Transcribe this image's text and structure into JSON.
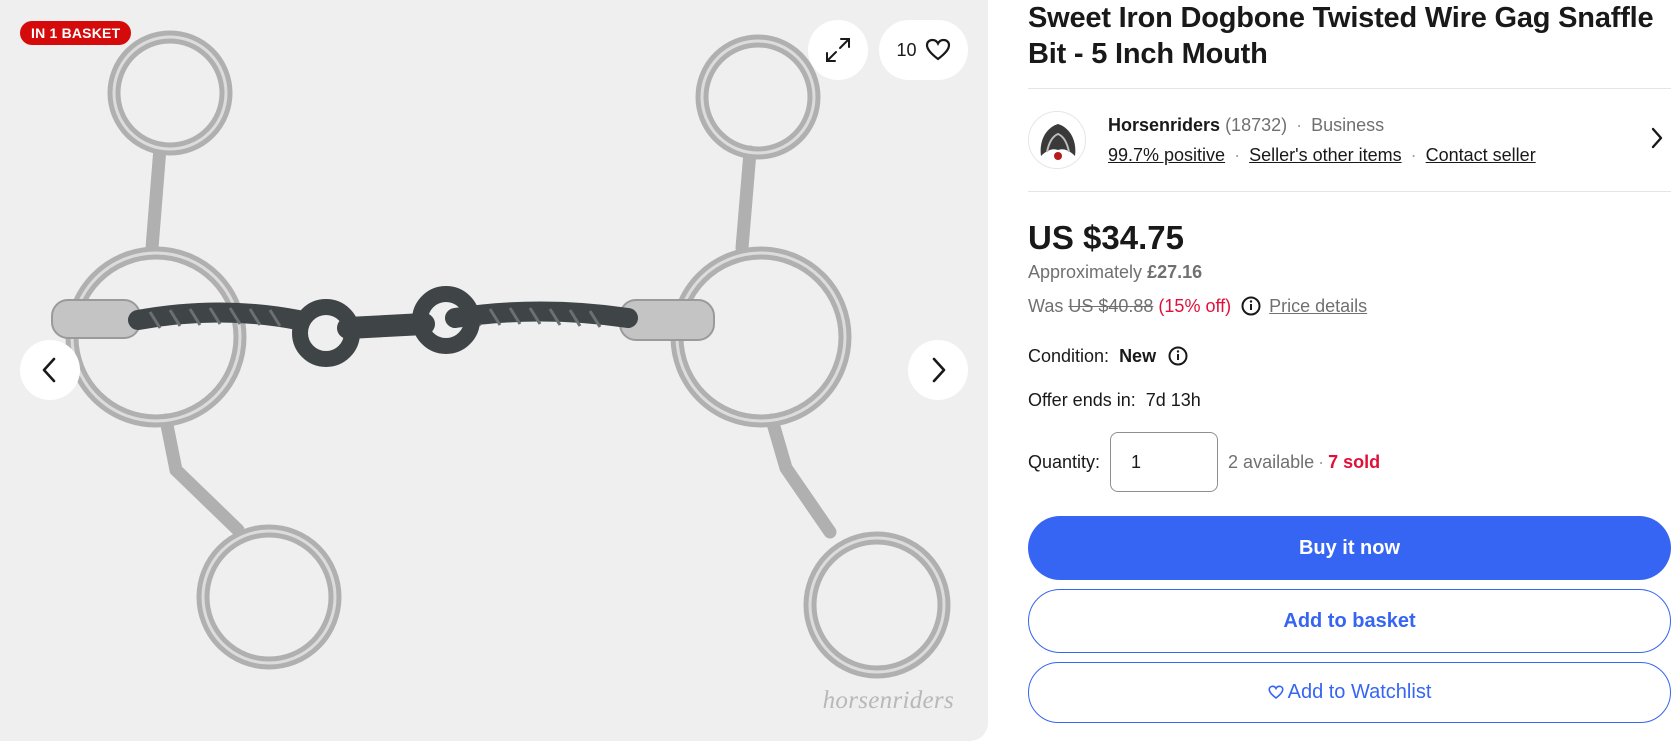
{
  "gallery": {
    "badge": "IN 1 BASKET",
    "watch_count": "10",
    "watermark": "horsenriders"
  },
  "icons": {
    "expand": "expand-icon",
    "heart": "heart-icon",
    "prev": "chevron-left-icon",
    "next": "chevron-right-icon",
    "info": "info-icon"
  },
  "product": {
    "title": "Sweet Iron Dogbone Twisted Wire Gag Snaffle Bit - 5 Inch Mouth"
  },
  "seller": {
    "name": "Horsenriders",
    "feedback_count": "(18732)",
    "type": "Business",
    "positive": "99.7% positive",
    "other_items": "Seller's other items",
    "contact": "Contact seller"
  },
  "pricing": {
    "price": "US $34.75",
    "approx_label": "Approximately",
    "approx_value": "£27.16",
    "was_label": "Was",
    "was_value": "US $40.88",
    "discount": "(15% off)",
    "price_details": "Price details"
  },
  "condition": {
    "label": "Condition:",
    "value": "New"
  },
  "offer": {
    "label": "Offer ends in:",
    "value": "7d 13h"
  },
  "quantity": {
    "label": "Quantity:",
    "value": "1",
    "available": "2 available",
    "sold": "7 sold"
  },
  "actions": {
    "buy": "Buy it now",
    "basket": "Add to basket",
    "watchlist": "Add to Watchlist"
  },
  "colors": {
    "accent": "#3665f3",
    "badge": "#d50b0b",
    "sale_red": "#e0103a"
  }
}
